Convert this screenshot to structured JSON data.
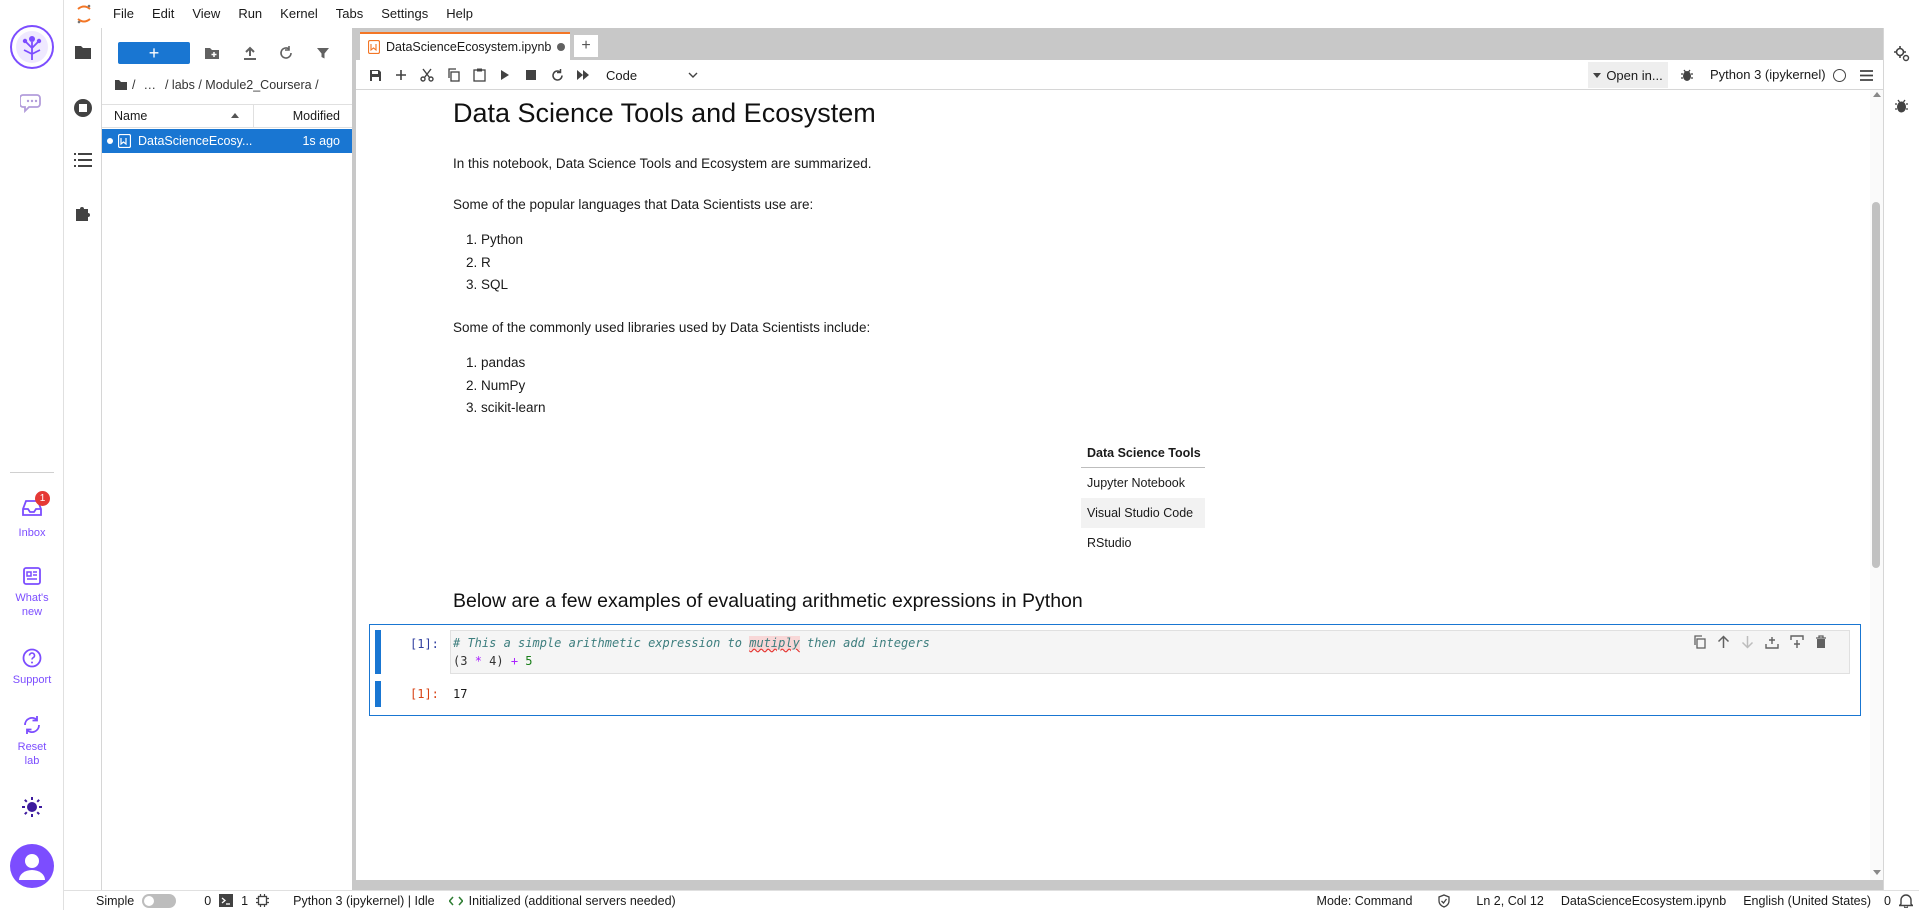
{
  "menubar": {
    "items": [
      "File",
      "Edit",
      "View",
      "Run",
      "Kernel",
      "Tabs",
      "Settings",
      "Help"
    ]
  },
  "left_rail": {
    "inbox_label": "Inbox",
    "inbox_badge": "1",
    "whats_new_label": "What's new",
    "support_label": "Support",
    "reset_label": "Reset lab"
  },
  "file_browser": {
    "new_button": "+",
    "breadcrumb": {
      "sep1": "/",
      "ellipsis": "…",
      "path": "/ labs / Module2_Coursera /"
    },
    "columns": {
      "name": "Name",
      "modified": "Modified"
    },
    "files": [
      {
        "name": "DataScienceEcosy...",
        "modified": "1s ago"
      }
    ]
  },
  "tabs": {
    "active_label": "DataScienceEcosystem.ipynb",
    "new_tab": "+"
  },
  "toolbar": {
    "cell_type": "Code",
    "open_in": "Open in...",
    "kernel_name": "Python 3 (ipykernel)"
  },
  "notebook": {
    "title": "Data Science Tools and Ecosystem",
    "intro": "In this notebook, Data Science Tools and Ecosystem are summarized.",
    "languages_intro": "Some of the popular languages that Data Scientists use are:",
    "languages": [
      "Python",
      "R",
      "SQL"
    ],
    "libraries_intro": "Some of the commonly used libraries used by Data Scientists include:",
    "libraries": [
      "pandas",
      "NumPy",
      "scikit-learn"
    ],
    "tools_table": {
      "header": "Data Science Tools",
      "rows": [
        "Jupyter Notebook",
        "Visual Studio Code",
        "RStudio"
      ]
    },
    "arith_heading": "Below are a few examples of evaluating arithmetic expressions in Python",
    "code_cell": {
      "prompt": "[1]:",
      "comment_before": "# This a simple arithmetic expression to ",
      "comment_misspelled": "mutiply",
      "comment_after": " then add integers",
      "line2_open": "(3 ",
      "line2_op1": "*",
      "line2_mid": " 4) ",
      "line2_op2": "+",
      "line2_end": " 5",
      "output_prompt": "[1]:",
      "output": "17"
    }
  },
  "statusbar": {
    "mode_label": "Simple",
    "terminals": "0",
    "kernels": "1",
    "kernel_status": "Python 3 (ipykernel) | Idle",
    "lsp_status": "Initialized (additional servers needed)",
    "mode": "Mode: Command",
    "cursor": "Ln 2, Col 12",
    "filename": "DataScienceEcosystem.ipynb",
    "language": "English (United States)",
    "notifications": "0"
  },
  "colors": {
    "accent": "#1976d2",
    "brand": "#f37626",
    "rail_purple": "#7c4dff",
    "selection": "#1976d2",
    "output_prompt": "#d84315"
  }
}
